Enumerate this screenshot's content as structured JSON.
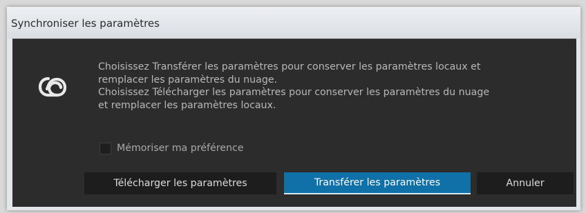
{
  "window": {
    "title": "Synchroniser les paramètres"
  },
  "dialog": {
    "icon": "creative-cloud-icon",
    "message_lines": [
      "Choisissez Transférer les paramètres pour conserver les paramètres locaux et",
      "remplacer les paramètres du nuage.",
      "Choisissez Télécharger les paramètres pour conserver les paramètres du nuage",
      "et remplacer les paramètres locaux."
    ],
    "remember_checkbox": {
      "label": "Mémoriser ma préférence",
      "checked": false
    },
    "buttons": {
      "download_label": "Télécharger les paramètres",
      "upload_label": "Transférer les paramètres",
      "cancel_label": "Annuler"
    }
  },
  "colors": {
    "panel_background": "#2c2c2c",
    "primary_button": "#1070a8",
    "button_background": "#1d1d1d",
    "text_muted": "#b8b8b8"
  }
}
